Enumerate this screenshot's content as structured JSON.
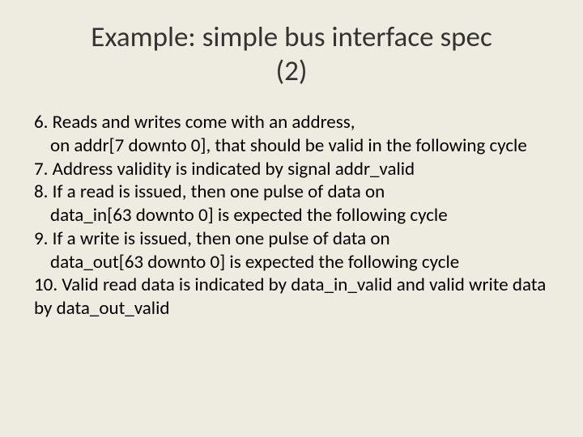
{
  "title": "Example: simple bus interface spec (2)",
  "items": {
    "i6_line1": "6. Reads and writes come with an address,",
    "i6_line2": "on addr[7 downto 0], that should be valid in the following cycle",
    "i7": "7. Address validity is indicated by signal addr_valid",
    "i8_line1": "8. If a read is issued, then one pulse of data on",
    "i8_line2": "data_in[63 downto 0] is expected the following cycle",
    "i9_line1": "9. If a write is issued, then one pulse of data on",
    "i9_line2": "data_out[63 downto 0] is expected the following cycle",
    "i10": "10. Valid read data is indicated by data_in_valid and valid write data by data_out_valid"
  }
}
